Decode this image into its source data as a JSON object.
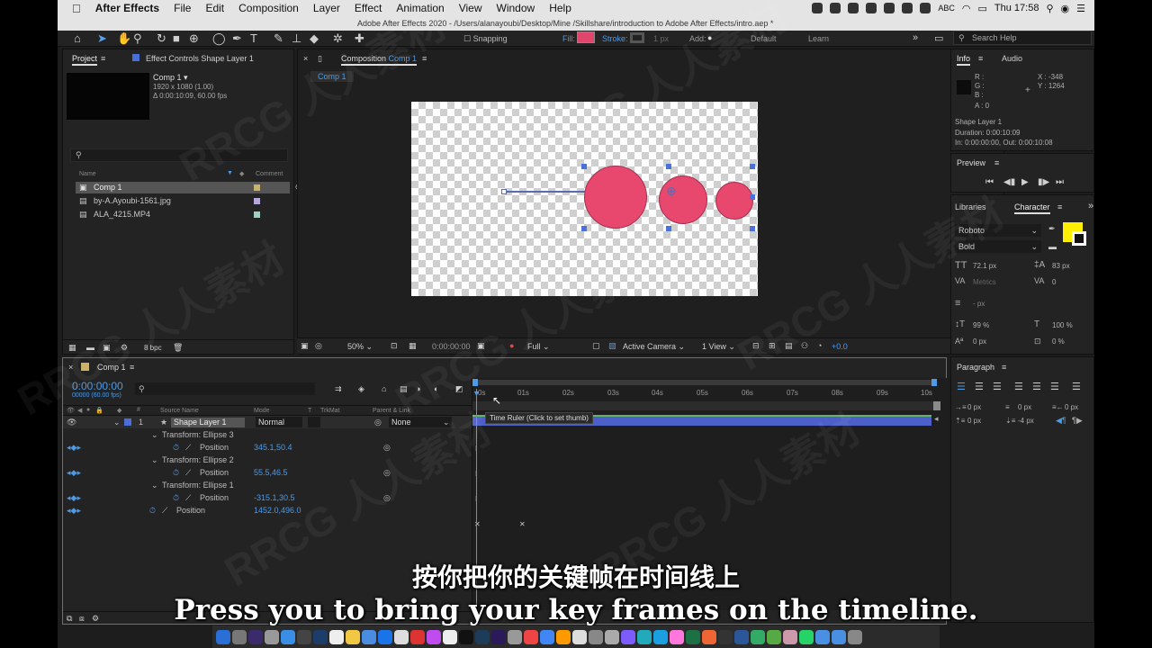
{
  "menubar": {
    "apple": "",
    "app": "After Effects",
    "items": [
      "File",
      "Edit",
      "Composition",
      "Layer",
      "Effect",
      "Animation",
      "View",
      "Window",
      "Help"
    ],
    "window_title": "Adobe After Effects 2020 - /Users/alanayoubi/Desktop/Mine /Skillshare/introduction to Adobe After Effects/intro.aep *",
    "input_source": "ABC",
    "clock": "Thu 17:58"
  },
  "toolbar": {
    "snapping": "Snapping",
    "fill_label": "Fill:",
    "stroke_label": "Stroke:",
    "stroke_width": "1 px",
    "add_label": "Add:",
    "workspace_default": "Default",
    "workspace_learn": "Learn",
    "search_placeholder": "Search Help",
    "fill_color": "#e0466b"
  },
  "project": {
    "tab_label": "Project",
    "effect_controls_label": "Effect Controls Shape Layer 1",
    "comp_name": "Comp 1 ▾",
    "comp_size": "1920 x 1080 (1.00)",
    "comp_duration": "Δ 0:00:10:09, 60.00 fps",
    "col_name": "Name",
    "col_comment": "Comment",
    "bpc": "8 bpc",
    "items": [
      {
        "name": "Comp 1",
        "color": "#c9b26a"
      },
      {
        "name": "by-A.Ayoubi-1561.jpg",
        "color": "#b3a7d8"
      },
      {
        "name": "ALA_4215.MP4",
        "color": "#9fd0c2"
      }
    ]
  },
  "composition": {
    "tab_prefix": "Composition",
    "tab_name": "Comp 1",
    "sub_tab": "Comp 1",
    "zoom": "50%",
    "timecode": "0:00:00:00",
    "resolution": "Full",
    "camera": "Active Camera",
    "views": "1 View",
    "exposure": "+0.0"
  },
  "info": {
    "tab_info": "Info",
    "tab_audio": "Audio",
    "r": "R :",
    "g": "G :",
    "b": "B :",
    "a": "A :  0",
    "x": "X :  -348",
    "y": "Y :  1264",
    "layer": "Shape Layer 1",
    "duration": "Duration: 0:00:10:09",
    "inout": "In: 0:00:00:00, Out: 0:00:10:08"
  },
  "preview": {
    "label": "Preview"
  },
  "character": {
    "tab_libraries": "Libraries",
    "tab_character": "Character",
    "font": "Roboto",
    "style": "Bold",
    "size": "72.1 px",
    "leading": "83 px",
    "kerning": "Metrics",
    "tracking": "0",
    "stroke_width": "- px",
    "vscale": "99 %",
    "hscale": "100 %",
    "baseline": "0 px",
    "tsume": "0 %",
    "fill_color": "#ffee00"
  },
  "paragraph": {
    "label": "Paragraph",
    "indent_left": "0 px",
    "indent_first": "0 px",
    "indent_right": "0 px",
    "space_before": "0 px",
    "space_after": "-4 px"
  },
  "timeline": {
    "tab_label": "Comp 1",
    "timecode": "0:00:00:00",
    "fps_info": "00000 (60.00 fps)",
    "col_source": "Source Name",
    "col_mode": "Mode",
    "col_t": "T",
    "col_trkmat": "TrkMat",
    "col_parent": "Parent & Link",
    "ruler_ticks": [
      "0s",
      "01s",
      "02s",
      "03s",
      "04s",
      "05s",
      "06s",
      "07s",
      "08s",
      "09s",
      "10s"
    ],
    "tooltip": "Time Ruler (Click to set thumb)",
    "layer": {
      "num": "1",
      "name": "Shape Layer 1",
      "mode": "Normal",
      "parent": "None"
    },
    "props": [
      {
        "label": "Transform: Ellipse 3",
        "value": ""
      },
      {
        "label": "Position",
        "value": "345.1,50.4"
      },
      {
        "label": "Transform: Ellipse 2",
        "value": ""
      },
      {
        "label": "Position",
        "value": "55.5,46.5"
      },
      {
        "label": "Transform: Ellipse 1",
        "value": ""
      },
      {
        "label": "Position",
        "value": "-315.1,30.5"
      },
      {
        "label": "Position",
        "value": "1452.0,496.0"
      }
    ]
  },
  "subtitles": {
    "zh": "按你把你的关键帧在时间线上",
    "en": "Press you to bring your key frames on the timeline."
  },
  "watermark": "RRCG 人人素材"
}
